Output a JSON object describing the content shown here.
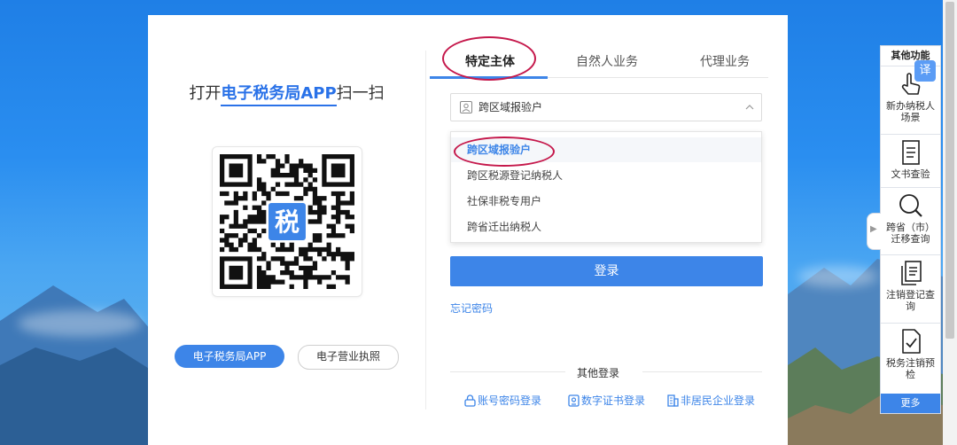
{
  "left": {
    "scan_prefix": "打开",
    "scan_app": "电子税务局APP",
    "scan_suffix": "扫一扫",
    "qr_center_glyph": "税",
    "btn_app": "电子税务局APP",
    "btn_license": "电子营业执照"
  },
  "tabs": [
    {
      "label": "特定主体",
      "active": true
    },
    {
      "label": "自然人业务",
      "active": false
    },
    {
      "label": "代理业务",
      "active": false
    }
  ],
  "select": {
    "value": "跨区域报验户",
    "icon": "user-card-icon"
  },
  "dropdown": [
    {
      "label": "跨区域报验户",
      "selected": true
    },
    {
      "label": "跨区税源登记纳税人",
      "selected": false
    },
    {
      "label": "社保非税专用户",
      "selected": false
    },
    {
      "label": "跨省迁出纳税人",
      "selected": false
    }
  ],
  "login_label": "登录",
  "forgot_label": "忘记密码",
  "other_login": {
    "title": "其他登录",
    "links": [
      {
        "label": "账号密码登录",
        "icon": "lock-icon"
      },
      {
        "label": "数字证书登录",
        "icon": "certificate-icon"
      },
      {
        "label": "非居民企业登录",
        "icon": "building-icon"
      }
    ]
  },
  "side_panel": {
    "title": "其他功能",
    "translate": "译",
    "items": [
      {
        "line1": "新办纳税人",
        "line2": "场景",
        "icon": "hand-pointer-icon"
      },
      {
        "line1": "文书查验",
        "line2": "",
        "icon": "document-icon"
      },
      {
        "line1": "跨省（市）",
        "line2": "迁移查询",
        "icon": "search-icon"
      },
      {
        "line1": "注销登记查",
        "line2": "询",
        "icon": "copy-document-icon"
      },
      {
        "line1": "税务注销预",
        "line2": "检",
        "icon": "check-document-icon"
      }
    ],
    "more": "更多"
  },
  "colors": {
    "accent": "#3d85e8",
    "annotation": "#c5184b"
  }
}
